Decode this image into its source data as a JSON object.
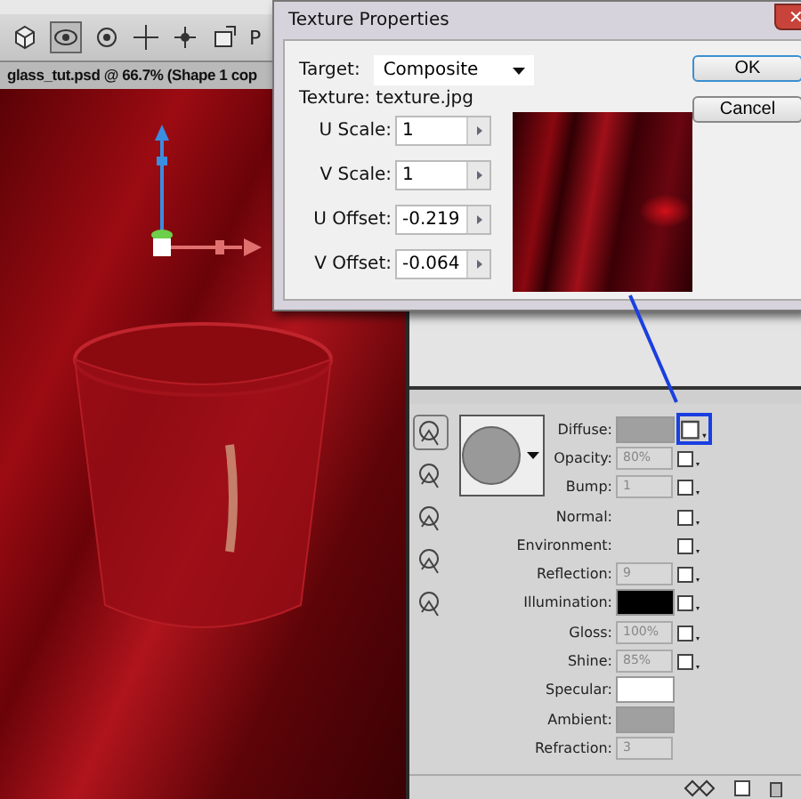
{
  "toolbar": {
    "label": "P"
  },
  "document_tab": {
    "title": "glass_tut.psd @ 66.7% (Shape 1 cop"
  },
  "dialog": {
    "title": "Texture Properties",
    "close": "✕",
    "target_label": "Target:",
    "target_value": "Composite",
    "texture_label": "Texture: texture.jpg",
    "fields": [
      {
        "label": "U Scale:",
        "value": "1"
      },
      {
        "label": "V Scale:",
        "value": "1"
      },
      {
        "label": "U Offset:",
        "value": "-0.219"
      },
      {
        "label": "V Offset:",
        "value": "-0.064"
      }
    ],
    "buttons": [
      {
        "label": "OK",
        "default": true
      },
      {
        "label": "Cancel",
        "default": false
      }
    ]
  },
  "materials": [
    {
      "label": "Diffuse:",
      "kind": "swatch",
      "color": "#a0a0a0",
      "texture": true,
      "highlighted": true
    },
    {
      "label": "Opacity:",
      "kind": "value",
      "value": "80%",
      "texture": true,
      "highlighted": false
    },
    {
      "label": "Bump:",
      "kind": "value",
      "value": "1",
      "texture": true,
      "highlighted": false
    },
    {
      "label": "Normal:",
      "kind": "none",
      "texture": true,
      "highlighted": false
    },
    {
      "label": "Environment:",
      "kind": "none",
      "texture": true,
      "highlighted": false
    },
    {
      "label": "Reflection:",
      "kind": "value",
      "value": "9",
      "texture": true,
      "highlighted": false
    },
    {
      "label": "Illumination:",
      "kind": "swatch",
      "color": "#000000",
      "texture": true,
      "highlighted": false
    },
    {
      "label": "Gloss:",
      "kind": "value",
      "value": "100%",
      "texture": true,
      "highlighted": false
    },
    {
      "label": "Shine:",
      "kind": "value",
      "value": "85%",
      "texture": true,
      "highlighted": false
    },
    {
      "label": "Specular:",
      "kind": "swatch",
      "color": "#ffffff",
      "texture": false
    },
    {
      "label": "Ambient:",
      "kind": "swatch",
      "color": "#a0a0a0",
      "texture": false
    },
    {
      "label": "Refraction:",
      "kind": "value",
      "value": "3",
      "texture": false
    }
  ]
}
